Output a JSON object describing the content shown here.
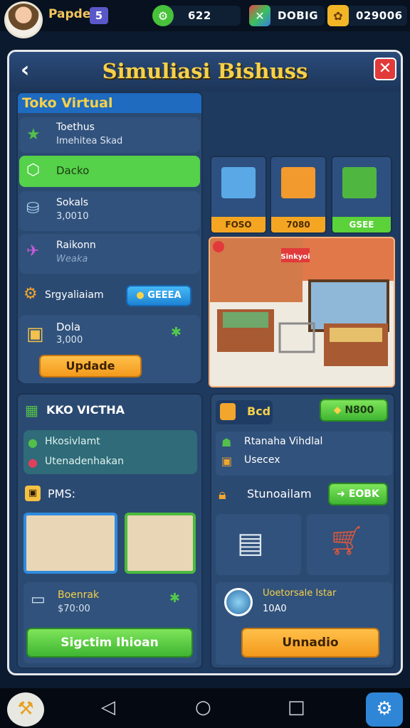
{
  "topbar": {
    "player_name": "Papden",
    "level": "5",
    "resources": [
      {
        "icon": "cash-icon",
        "value": "622"
      },
      {
        "icon": "xp-icon",
        "value": "DOBIG"
      },
      {
        "icon": "coin-icon",
        "value": "029006"
      }
    ]
  },
  "window": {
    "title": "Simuliasi Bishuss",
    "back_icon": "chevron-left-icon",
    "close_icon": "close-icon"
  },
  "left_panel": {
    "header": "Toko Virtual",
    "items": [
      {
        "title": "Toethus",
        "subtitle": "Imehitea Skad",
        "icon": "star-icon"
      },
      {
        "title": "Dacko",
        "subtitle": "",
        "icon": "box-icon"
      },
      {
        "title": "Sokals",
        "subtitle": "3,0010",
        "icon": "jar-icon"
      },
      {
        "title": "Raikonn",
        "subtitle": "Weaka",
        "icon": "plane-icon"
      }
    ],
    "upgrade_row": {
      "label": "Srgyaliaiam",
      "button": "GEEEA"
    },
    "product": {
      "title": "Dola",
      "value": "3,000"
    },
    "update_button": "Updade"
  },
  "shelf_cards": [
    {
      "label": "FOSO",
      "color": "#f4a622",
      "art": "#5aa9e6"
    },
    {
      "label": "7080",
      "color": "#f4a622",
      "art": "#f29a2e"
    },
    {
      "label": "GSEE",
      "color": "#5bd13a",
      "art": "#4fb640"
    }
  ],
  "store_scene": {
    "sign": "Sinkyoi"
  },
  "left_bottom": {
    "section_title": "KKO VICTHA",
    "stats": [
      {
        "label": "Hkosivlamt",
        "icon": "green-dot-icon"
      },
      {
        "label": "Utenadenhakan",
        "icon": "red-dot-icon"
      }
    ],
    "pms_label": "PMS:",
    "item": {
      "title": "Boenrak",
      "value": "$70:00"
    },
    "primary_button": "Sigctim Ihioan"
  },
  "right_bottom": {
    "header": "Bcd",
    "header_button": "N800",
    "lines": [
      "Rtanaha Vihdlal",
      "Usecex"
    ],
    "section_title": "Stunoailam",
    "section_button": "EOBK",
    "info": {
      "title": "Uoetorsale Istar",
      "value": "10A0"
    },
    "primary_button": "Unnadio"
  }
}
